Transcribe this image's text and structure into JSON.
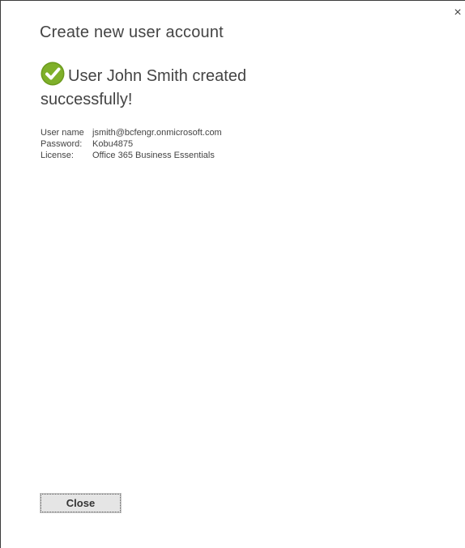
{
  "dialog": {
    "close_glyph": "×",
    "title": "Create new user account",
    "success_message": "User John Smith created successfully!",
    "success_icon": "check-circle-icon",
    "accent_color": "#6b9a1c"
  },
  "details": [
    {
      "label": "User name",
      "value": "jsmith@bcfengr.onmicrosoft.com"
    },
    {
      "label": "Password:",
      "value": "Kobu4875"
    },
    {
      "label": "License:",
      "value": "Office 365 Business Essentials"
    }
  ],
  "buttons": {
    "close_label": "Close"
  }
}
